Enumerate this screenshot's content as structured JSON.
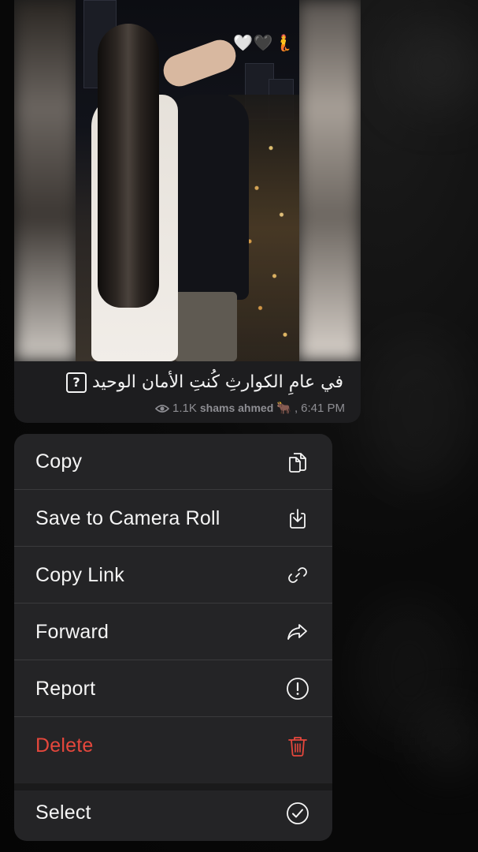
{
  "message": {
    "caption": "في عامِ الكوارثِ كُنتِ الأمان الوحيد",
    "caption_badge": "?",
    "views": "1.1K",
    "author": "shams ahmed",
    "author_emoji": "🐂",
    "separator": ",",
    "time": "6:41 PM",
    "photo_emoji": [
      "🤍",
      "🖤",
      "🧜"
    ]
  },
  "menu": {
    "items": [
      {
        "label": "Copy",
        "icon": "copy-icon"
      },
      {
        "label": "Save to Camera Roll",
        "icon": "download-icon"
      },
      {
        "label": "Copy Link",
        "icon": "link-icon"
      },
      {
        "label": "Forward",
        "icon": "forward-arrow-icon"
      },
      {
        "label": "Report",
        "icon": "exclamation-circle-icon"
      },
      {
        "label": "Delete",
        "icon": "trash-icon",
        "color": "#e5473c"
      },
      {
        "label": "Select",
        "icon": "checkmark-circle-icon"
      }
    ]
  },
  "colors": {
    "menu_bg": "#242426",
    "danger": "#e5473c",
    "meta_text": "#8e8e93"
  }
}
